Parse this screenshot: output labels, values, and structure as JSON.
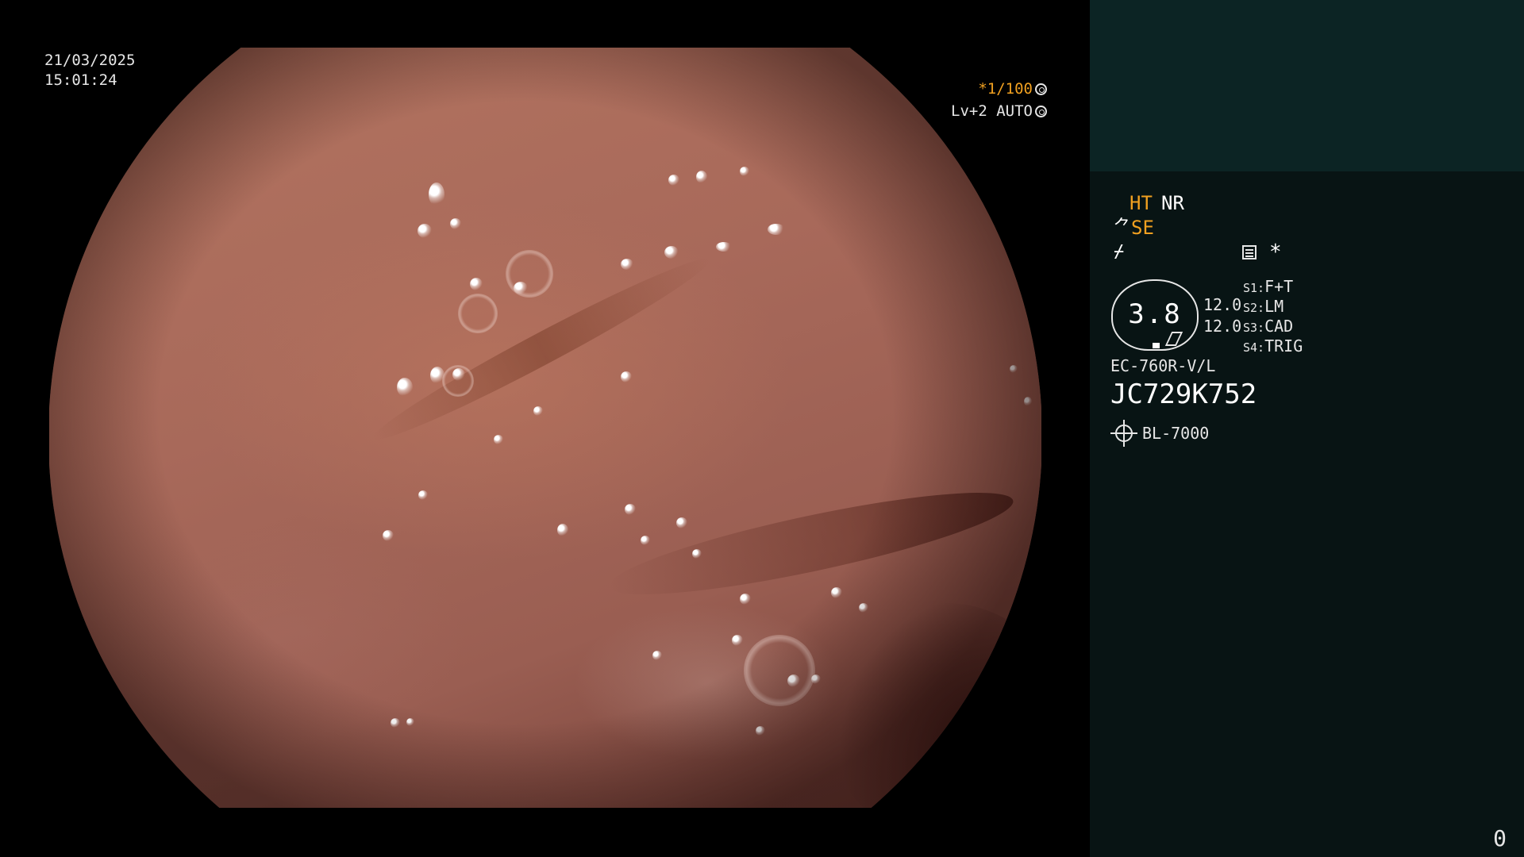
{
  "overlay": {
    "date": "21/03/2025",
    "time": "15:01:24",
    "shutter": "*1/100",
    "level": "Lv+2 AUTO"
  },
  "panel": {
    "ht": "HT",
    "nr": "NR",
    "se": "SE",
    "se_icon": "⺈",
    "f_icon": "⌿",
    "star": "*",
    "gauge_value": "3.8",
    "values": [
      "12.0",
      "12.0"
    ],
    "settings": [
      {
        "key": "S1:",
        "value": "F+T"
      },
      {
        "key": "S2:",
        "value": "LM"
      },
      {
        "key": "S3:",
        "value": "CAD"
      },
      {
        "key": "S4:",
        "value": "TRIG"
      }
    ],
    "scope_model": "EC-760R-V/L",
    "serial": "JC729K752",
    "light_source": "BL-7000",
    "counter": "0"
  },
  "colors": {
    "accent": "#f0a020",
    "panel_bg": "#081414",
    "panel_top": "#0c2424",
    "tissue": "#a8695a"
  },
  "icons": [
    "aperture-icon",
    "iris-icon",
    "document-icon",
    "light-source-icon"
  ]
}
